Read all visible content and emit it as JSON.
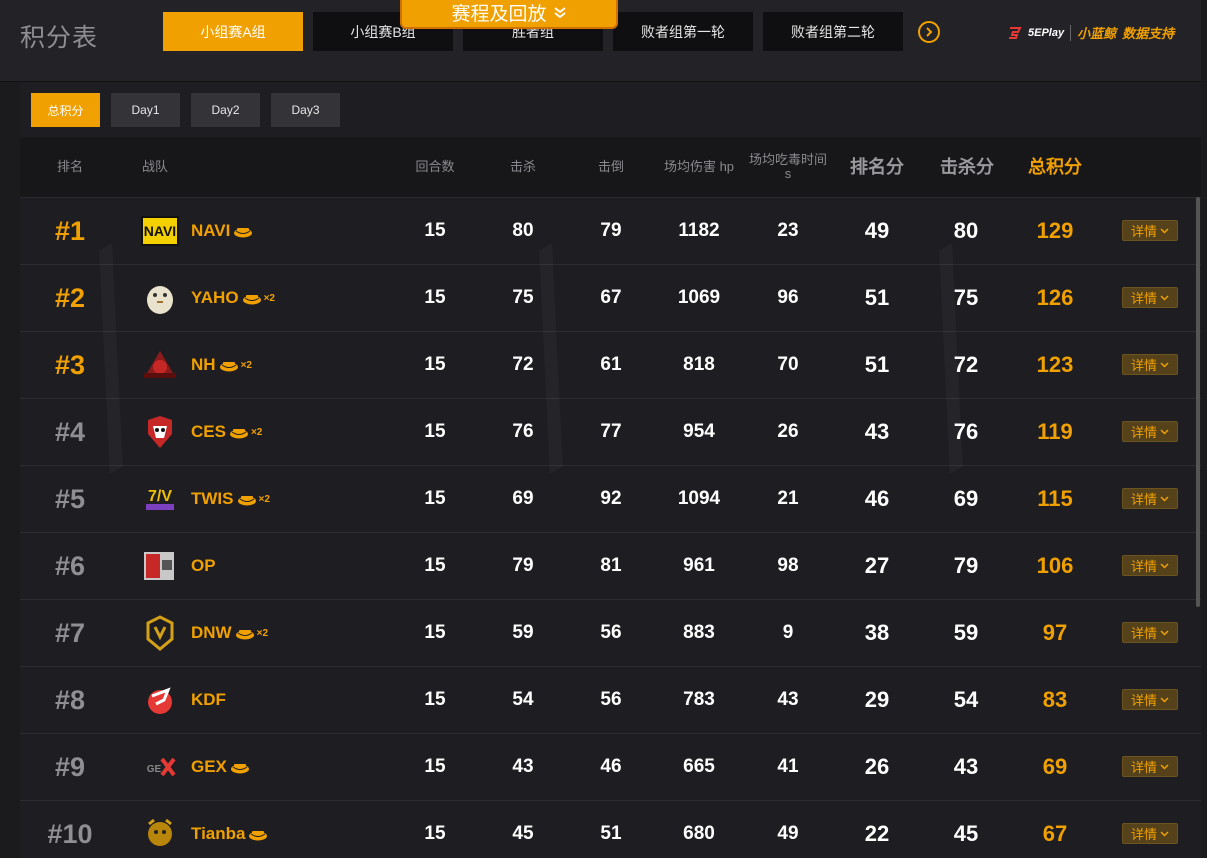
{
  "page_title": "积分表",
  "stage_tabs": [
    "小组赛A组",
    "小组赛B组",
    "胜者组",
    "败者组第一轮",
    "败者组第二轮"
  ],
  "active_stage_index": 0,
  "schedule_button": "赛程及回放",
  "sponsor": {
    "brand": "5EPlay",
    "text": "数据支持",
    "partner": "小蓝鲸"
  },
  "day_tabs": [
    "总积分",
    "Day1",
    "Day2",
    "Day3"
  ],
  "active_day_index": 0,
  "columns": {
    "rank": "排名",
    "team": "战队",
    "rounds": "回合数",
    "kills": "击杀",
    "knocks": "击倒",
    "avg_damage": "场均伤害 hp",
    "avg_poison_time": "场均吃毒时间 s",
    "placement_pts": "排名分",
    "kill_pts": "击杀分",
    "total_pts": "总积分"
  },
  "detail_label": "详情",
  "colors": {
    "accent": "#f0a000",
    "bg": "#1e1e22",
    "rank_top": "#f0a000",
    "rank_other": "#8f8f93"
  },
  "rows": [
    {
      "rank": "#1",
      "team": "NAVI",
      "chicken": 1,
      "rounds": 15,
      "kills": 80,
      "knocks": 79,
      "avg_damage": 1182,
      "poison_time": 23,
      "placement_pts": 49,
      "kill_pts": 80,
      "total_pts": 129,
      "logo": "navi-logo"
    },
    {
      "rank": "#2",
      "team": "YAHO",
      "chicken": 2,
      "rounds": 15,
      "kills": 75,
      "knocks": 67,
      "avg_damage": 1069,
      "poison_time": 96,
      "placement_pts": 51,
      "kill_pts": 75,
      "total_pts": 126,
      "logo": "yaho-logo"
    },
    {
      "rank": "#3",
      "team": "NH",
      "chicken": 2,
      "rounds": 15,
      "kills": 72,
      "knocks": 61,
      "avg_damage": 818,
      "poison_time": 70,
      "placement_pts": 51,
      "kill_pts": 72,
      "total_pts": 123,
      "logo": "nh-logo"
    },
    {
      "rank": "#4",
      "team": "CES",
      "chicken": 2,
      "rounds": 15,
      "kills": 76,
      "knocks": 77,
      "avg_damage": 954,
      "poison_time": 26,
      "placement_pts": 43,
      "kill_pts": 76,
      "total_pts": 119,
      "logo": "ces-logo"
    },
    {
      "rank": "#5",
      "team": "TWIS",
      "chicken": 2,
      "rounds": 15,
      "kills": 69,
      "knocks": 92,
      "avg_damage": 1094,
      "poison_time": 21,
      "placement_pts": 46,
      "kill_pts": 69,
      "total_pts": 115,
      "logo": "twis-logo"
    },
    {
      "rank": "#6",
      "team": "OP",
      "chicken": 0,
      "rounds": 15,
      "kills": 79,
      "knocks": 81,
      "avg_damage": 961,
      "poison_time": 98,
      "placement_pts": 27,
      "kill_pts": 79,
      "total_pts": 106,
      "logo": "op-logo"
    },
    {
      "rank": "#7",
      "team": "DNW",
      "chicken": 2,
      "rounds": 15,
      "kills": 59,
      "knocks": 56,
      "avg_damage": 883,
      "poison_time": 9,
      "placement_pts": 38,
      "kill_pts": 59,
      "total_pts": 97,
      "logo": "dnw-logo"
    },
    {
      "rank": "#8",
      "team": "KDF",
      "chicken": 0,
      "rounds": 15,
      "kills": 54,
      "knocks": 56,
      "avg_damage": 783,
      "poison_time": 43,
      "placement_pts": 29,
      "kill_pts": 54,
      "total_pts": 83,
      "logo": "kdf-logo"
    },
    {
      "rank": "#9",
      "team": "GEX",
      "chicken": 1,
      "rounds": 15,
      "kills": 43,
      "knocks": 46,
      "avg_damage": 665,
      "poison_time": 41,
      "placement_pts": 26,
      "kill_pts": 43,
      "total_pts": 69,
      "logo": "gex-logo"
    },
    {
      "rank": "#10",
      "team": "Tianba",
      "chicken": 1,
      "rounds": 15,
      "kills": 45,
      "knocks": 51,
      "avg_damage": 680,
      "poison_time": 49,
      "placement_pts": 22,
      "kill_pts": 45,
      "total_pts": 67,
      "logo": "tianba-logo"
    }
  ]
}
